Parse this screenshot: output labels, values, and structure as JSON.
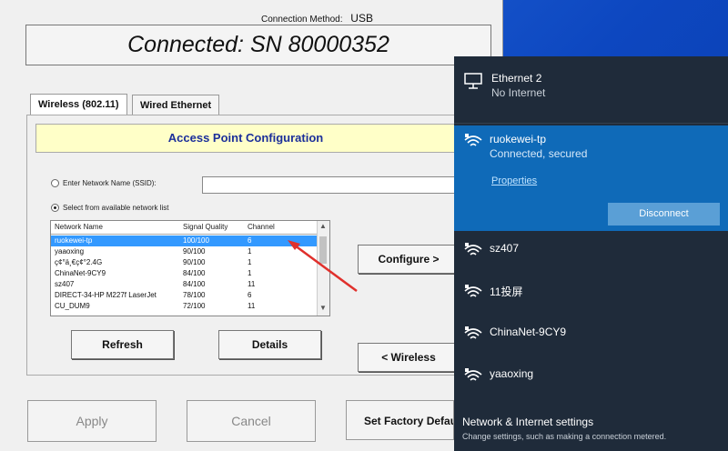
{
  "app": {
    "connection_method_label": "Connection Method:",
    "connection_method_value": "USB",
    "status_text": "Connected: SN 80000352",
    "tabs": [
      "Wireless (802.11)",
      "Wired Ethernet"
    ],
    "banner": "Access Point Configuration",
    "ssid_option": "Enter Network Name (SSID):",
    "list_option": "Select from available network list",
    "columns": [
      "Network Name",
      "Signal Quality",
      "Channel"
    ],
    "networks": [
      {
        "name": "ruokewei-tp",
        "quality": "100/100",
        "channel": "6"
      },
      {
        "name": "yaaoxing",
        "quality": "90/100",
        "channel": "1"
      },
      {
        "name": "ç¢°ä¸€ç¢°2.4G",
        "quality": "90/100",
        "channel": "1"
      },
      {
        "name": "ChinaNet-9CY9",
        "quality": "84/100",
        "channel": "1"
      },
      {
        "name": "sz407",
        "quality": "84/100",
        "channel": "11"
      },
      {
        "name": "DIRECT-34-HP M227f LaserJet",
        "quality": "78/100",
        "channel": "6"
      },
      {
        "name": "CU_DUM9",
        "quality": "72/100",
        "channel": "11"
      }
    ],
    "buttons": {
      "refresh": "Refresh",
      "details": "Details",
      "configure": "Configure >",
      "wireless": "< Wireless",
      "apply": "Apply",
      "cancel": "Cancel",
      "factory": "Set Factory Defaul"
    }
  },
  "flyout": {
    "ethernet": {
      "title": "Ethernet 2",
      "status": "No Internet"
    },
    "active": {
      "name": "ruokewei-tp",
      "status": "Connected, secured",
      "properties": "Properties",
      "disconnect": "Disconnect"
    },
    "networks": [
      "sz407",
      "11投屏",
      "ChinaNet-9CY9",
      "yaaoxing"
    ],
    "settings_title": "Network & Internet settings",
    "settings_sub": "Change settings, such as making a connection metered."
  },
  "colors": {
    "selection": "#3399ff",
    "active_network_bg": "#0f6ab8",
    "flyout_bg": "#1f2b3a",
    "banner_bg": "#ffffc8",
    "arrow": "#e0302c"
  }
}
